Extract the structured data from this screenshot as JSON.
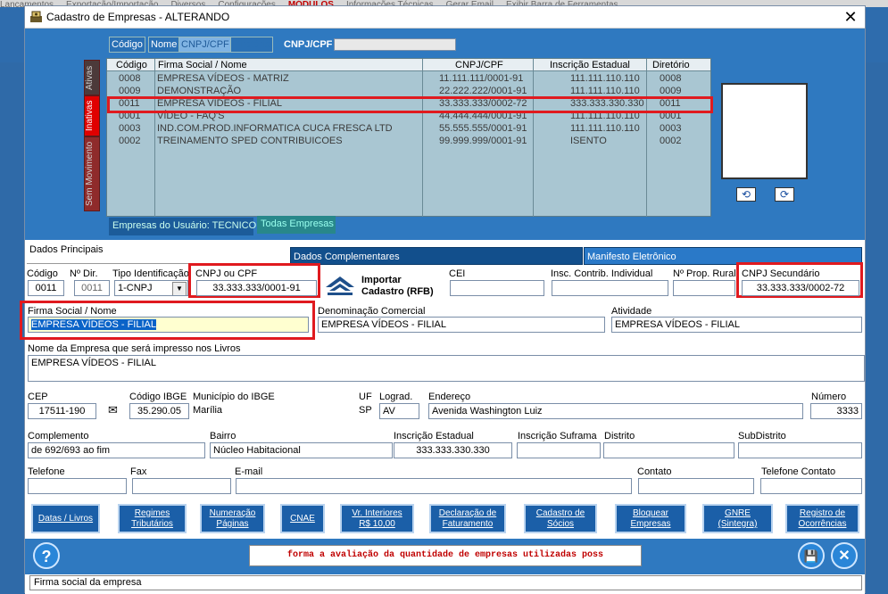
{
  "background": {
    "menu_items": [
      "Lancamentos",
      "Exportação/Importação",
      "Diversos",
      "Configurações",
      "MÓDULOS",
      "Informações Técnicas",
      "Gerar Email",
      "Exibir Barra de Ferramentas"
    ]
  },
  "window": {
    "title": "Cadastro de Empresas   -  ALTERANDO",
    "close": "✕"
  },
  "top_tabs": {
    "codigo": "Código",
    "nome": "Nome",
    "cnpj": "CNPJ/CPF",
    "hidden": "Diretório",
    "search_label": "CNPJ/CPF"
  },
  "side_tabs": {
    "ativas": "Ativas",
    "inativas": "Inativas",
    "sem_movimento": "Sem Movimento"
  },
  "grid": {
    "columns": [
      "Código",
      "Firma Social / Nome",
      "CNPJ/CPF",
      "Inscrição Estadual",
      "Diretório"
    ],
    "rows": [
      [
        "0008",
        "EMPRESA VÍDEOS - MATRIZ",
        "11.111.111/0001-91",
        "111.111.110.110",
        "0008"
      ],
      [
        "0009",
        "DEMONSTRAÇÃO",
        "22.222.222/0001-91",
        "111.111.110.110",
        "0009"
      ],
      [
        "0011",
        "EMPRESA VÍDEOS - FILIAL",
        "33.333.333/0002-72",
        "333.333.330.330",
        "0011"
      ],
      [
        "0001",
        "VÍDEO - FAQ'S",
        "44.444.444/0001-91",
        "111.111.110.110",
        "0001"
      ],
      [
        "0003",
        "IND.COM.PROD.INFORMATICA CUCA FRESCA LTD",
        "55.555.555/0001-91",
        "111.111.110.110",
        "0003"
      ],
      [
        "0002",
        "TREINAMENTO SPED CONTRIBUICOES",
        "99.999.999/0001-91",
        "ISENTO",
        "0002"
      ]
    ]
  },
  "bottom_tabs": {
    "usuario": "Empresas do Usuário: TECNICO",
    "todas": "Todas Empresas"
  },
  "section_tabs": [
    "Dados Principais",
    "Dados Complementares",
    "Manifesto Eletrônico"
  ],
  "labels": {
    "codigo": "Código",
    "dir": "Nº Dir.",
    "tipo": "Tipo Identificação",
    "cnpj": "CNPJ ou CPF",
    "importar": "Importar\nCadastro (RFB)",
    "cei": "CEI",
    "insc_ind": "Insc. Contrib. Individual",
    "prop_rural": "Nº Prop. Rural",
    "cnpj_sec": "CNPJ Secundário",
    "firma": "Firma Social / Nome",
    "denominacao": "Denominação Comercial",
    "atividade": "Atividade",
    "nome_livros": "Nome da Empresa que será impresso nos Livros",
    "cep": "CEP",
    "cod_ibge": "Código IBGE",
    "mun_ibge": "Município do IBGE",
    "uf": "UF",
    "lograd": "Lograd.",
    "endereco": "Endereço",
    "numero": "Número",
    "complemento": "Complemento",
    "bairro": "Bairro",
    "insc_est": "Inscrição Estadual",
    "insc_suframa": "Inscrição Suframa",
    "distrito": "Distrito",
    "subdistrito": "SubDistrito",
    "telefone": "Telefone",
    "fax": "Fax",
    "email": "E-mail",
    "contato": "Contato",
    "tel_contato": "Telefone Contato"
  },
  "values": {
    "codigo": "0011",
    "dir": "0011",
    "tipo": "1-CNPJ",
    "cnpj": "33.333.333/0001-91",
    "cnpj_sec": "33.333.333/0002-72",
    "firma": "EMPRESA VÍDEOS - FILIAL",
    "denominacao": "EMPRESA VÍDEOS - FILIAL",
    "atividade": "EMPRESA VÍDEOS - FILIAL",
    "nome_livros": "EMPRESA VÍDEOS - FILIAL",
    "cep": "17511-190",
    "cod_ibge": "35.290.05",
    "municipio": "Marília",
    "uf": "SP",
    "lograd": "AV",
    "endereco": "Avenida Washington Luiz",
    "numero": "3333",
    "complemento": "de 692/693 ao fim",
    "bairro": "Núcleo Habitacional",
    "insc_est": "333.333.330.330"
  },
  "buttons": [
    "Datas / Livros",
    "Regimes\nTributários",
    "Numeração\nPáginas",
    "CNAE",
    "Vr. Interiores\nR$ 10,00",
    "Declaração de\nFaturamento",
    "Cadastro de\nSócios",
    "Bloquear\nEmpresas",
    "GNRE\n(Sintegra)",
    "Registro de\nOcorrências"
  ],
  "message": "forma a avaliação da quantidade de empresas utilizadas poss",
  "status": "Firma social da empresa",
  "icons": {
    "help": "?",
    "save": "💾",
    "close": "✕"
  }
}
